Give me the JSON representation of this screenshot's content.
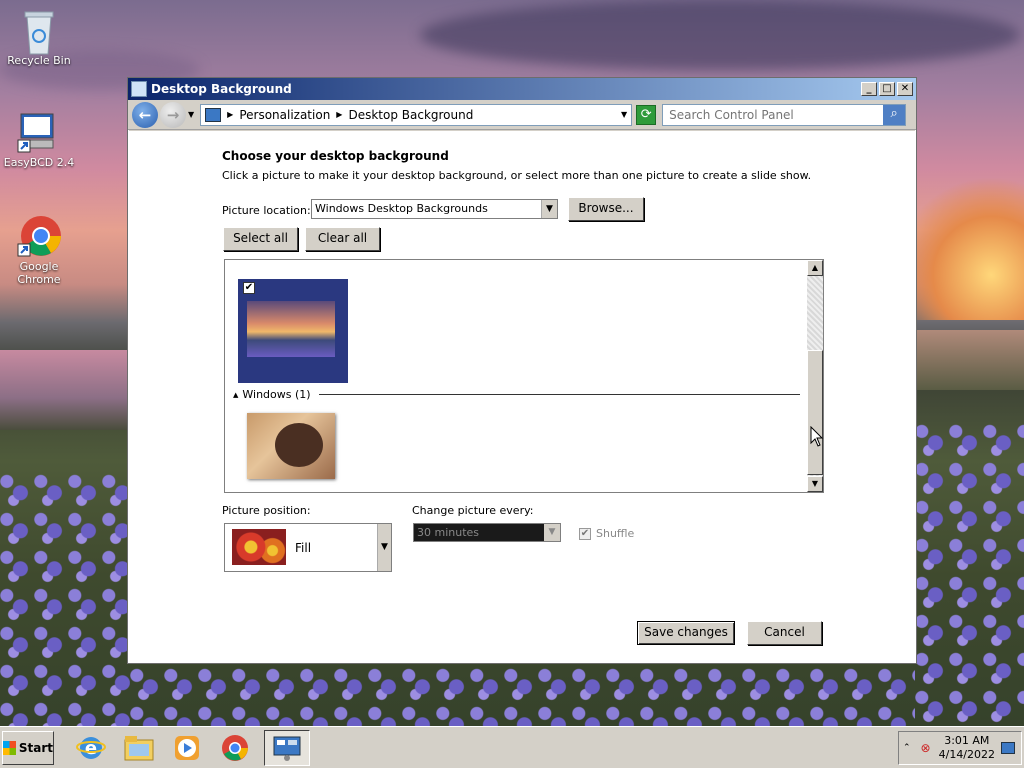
{
  "desktop": {
    "icons": [
      {
        "label": "Recycle Bin"
      },
      {
        "label": "EasyBCD 2.4"
      },
      {
        "label": "Google Chrome"
      }
    ]
  },
  "window": {
    "title": "Desktop Background",
    "controls": {
      "minimize": "_",
      "maximize": "□",
      "close": "✕"
    },
    "address": {
      "breadcrumbs": [
        "Personalization",
        "Desktop Background"
      ]
    },
    "search": {
      "placeholder": "Search Control Panel"
    }
  },
  "page": {
    "heading": "Choose your desktop background",
    "description": "Click a picture to make it your desktop background, or select more than one picture to create a slide show.",
    "picture_location_label": "Picture location:",
    "picture_location_value": "Windows Desktop Backgrounds",
    "browse_label": "Browse...",
    "select_all_label": "Select all",
    "clear_all_label": "Clear all",
    "group_label": "Windows (1)",
    "picture_position_label": "Picture position:",
    "picture_position_value": "Fill",
    "change_every_label": "Change picture every:",
    "change_every_value": "30 minutes",
    "shuffle_label": "Shuffle",
    "save_label": "Save changes",
    "cancel_label": "Cancel"
  },
  "taskbar": {
    "start_label": "Start",
    "apps": [
      "internet-explorer",
      "windows-explorer",
      "media-player",
      "google-chrome",
      "control-panel"
    ],
    "clock_time": "3:01 AM",
    "clock_date": "4/14/2022"
  },
  "colors": {
    "titlebar": "#0a246a",
    "selected_thumb_bg": "#2a3880",
    "accent_refresh": "#2f9b3b"
  }
}
